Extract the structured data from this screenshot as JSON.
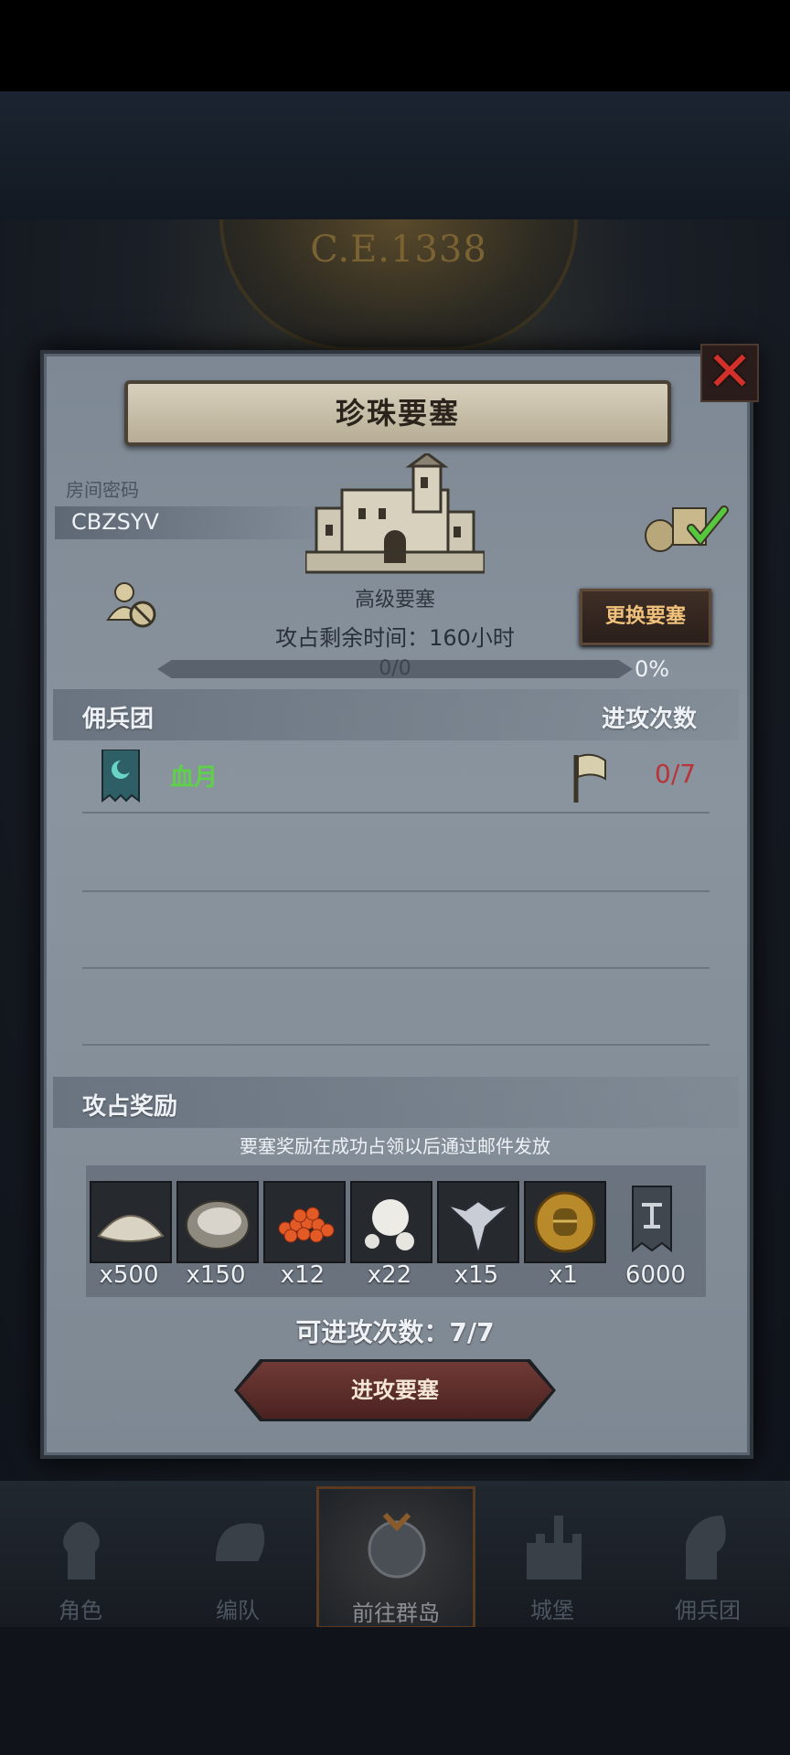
{
  "background": {
    "era_label": "C.E.1338"
  },
  "dialog": {
    "title": "珍珠要塞",
    "room_code_label": "房间密码",
    "room_code": "CBZSYV",
    "fort_type": "高级要塞",
    "change_fort_label": "更换要塞",
    "timer_text": "攻占剩余时间：160小时",
    "progress_text": "0/0",
    "progress_percent": "0%",
    "progress_value": 0,
    "mercenary_header": "佣兵团",
    "attack_count_header": "进攻次数",
    "mercenaries": [
      {
        "name": "血月",
        "attacks": "0/7",
        "color": "#5fd04a"
      }
    ],
    "rewards_header": "攻占奖励",
    "rewards_note": "要塞奖励在成功占领以后通过邮件发放",
    "rewards": [
      {
        "icon": "flour-pile-icon",
        "qty": "x500"
      },
      {
        "icon": "oyster-icon",
        "qty": "x150"
      },
      {
        "icon": "roe-icon",
        "qty": "x12"
      },
      {
        "icon": "pearl-icon",
        "qty": "x22"
      },
      {
        "icon": "winged-emblem-icon",
        "qty": "x15"
      },
      {
        "icon": "helmet-coin-icon",
        "qty": "x1"
      },
      {
        "icon": "banner-icon",
        "qty": "6000"
      }
    ],
    "attacks_remaining": "可进攻次数：7/7",
    "attack_button_label": "进攻要塞"
  },
  "nav": {
    "items": [
      {
        "label": "角色",
        "icon": "knight-icon"
      },
      {
        "label": "编队",
        "icon": "helmet-icon"
      },
      {
        "label": "前往群岛",
        "icon": "island-map-icon",
        "active": true
      },
      {
        "label": "城堡",
        "icon": "castle-icon"
      },
      {
        "label": "佣兵团",
        "icon": "mercenary-icon"
      }
    ]
  },
  "colors": {
    "accent_gold": "#f0c17a",
    "danger_red": "#b8343a",
    "ally_green": "#5fd04a"
  }
}
